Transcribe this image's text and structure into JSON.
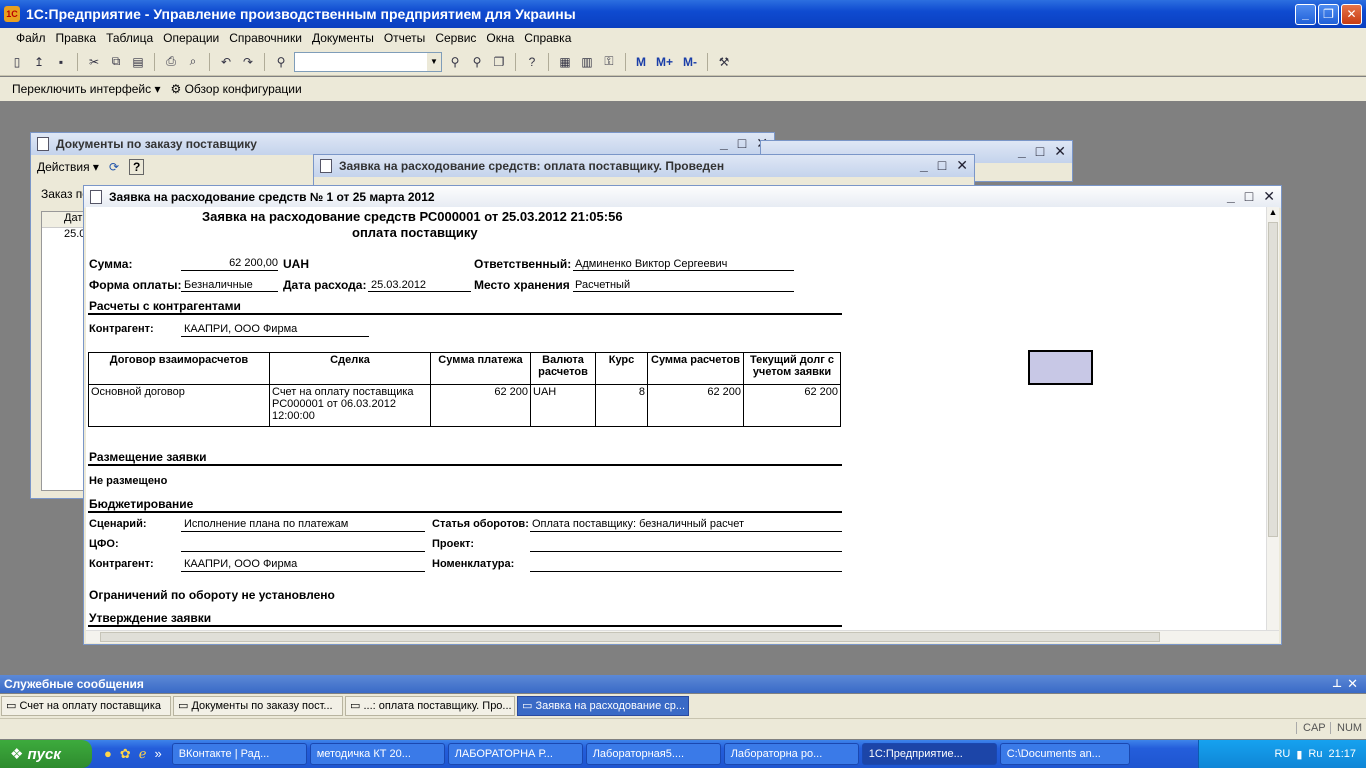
{
  "app": {
    "title": "1С:Предприятие - Управление производственным предприятием для Украины",
    "logo": "1С"
  },
  "menu": [
    "Файл",
    "Правка",
    "Таблица",
    "Операции",
    "Справочники",
    "Документы",
    "Отчеты",
    "Сервис",
    "Окна",
    "Справка"
  ],
  "toolbar2": {
    "switch_interface": "Переключить интерфейс",
    "config_overview": "Обзор конфигурации"
  },
  "memory_buttons": [
    "M",
    "M+",
    "M-"
  ],
  "win_docs": {
    "title": "Документы по заказу поставщику",
    "actions": "Действия",
    "label_prefix": "Заказ по",
    "col_date": "Дат",
    "row_date": "25.0"
  },
  "win_request": {
    "title": "Заявка на расходование средств: оплата поставщику. Проведен"
  },
  "win_report": {
    "title": "Заявка на расходование средств № 1 от 25 марта 2012",
    "heading1": "Заявка на расходование средств РС000001 от 25.03.2012 21:05:56",
    "heading2": "оплата поставщику",
    "sum_label": "Сумма:",
    "sum_value": "62 200,00",
    "currency": "UAH",
    "responsible_label": "Ответственный:",
    "responsible_value": "Админенко Виктор Сергеевич",
    "pay_form_label": "Форма оплаты:",
    "pay_form_value": "Безналичные",
    "date_label": "Дата расхода:",
    "date_value": "25.03.2012",
    "storage_label": "Место хранения",
    "storage_value": "Расчетный",
    "section_settlements": "Расчеты с контрагентами",
    "counterparty_label": "Контрагент:",
    "counterparty_value": "КААПРИ, ООО Фирма",
    "table_headers": [
      "Договор взаиморасчетов",
      "Сделка",
      "Сумма платежа",
      "Валюта расчетов",
      "Курс",
      "Сумма расчетов",
      "Текущий долг с учетом заявки"
    ],
    "table_row": {
      "contract": "Основной договор",
      "deal": "Счет на оплату поставщика РС000001 от 06.03.2012 12:00:00",
      "pay_sum": "62 200",
      "currency": "UAH",
      "rate": "8",
      "settle_sum": "62 200",
      "debt": "62 200"
    },
    "section_placement": "Размещение заявки",
    "placement_value": "Не размещено",
    "section_budget": "Бюджетирование",
    "scenario_label": "Сценарий:",
    "scenario_value": "Исполнение плана по платежам",
    "turnover_label": "Статья оборотов:",
    "turnover_value": "Оплата поставщику: безналичный расчет",
    "cfo_label": "ЦФО:",
    "project_label": "Проект:",
    "counterparty2_label": "Контрагент:",
    "counterparty2_value": "КААПРИ, ООО Фирма",
    "nomenclature_label": "Номенклатура:",
    "limits_text": "Ограничений по обороту не установлено",
    "section_approval": "Утверждение заявки"
  },
  "service_messages": "Служебные сообщения",
  "window_tabs": [
    "Счет на оплату поставщика",
    "Документы по заказу пост...",
    "...: оплата поставщику. Про...",
    "Заявка на расходование ср..."
  ],
  "status": {
    "cap": "CAP",
    "num": "NUM"
  },
  "taskbar": {
    "start": "пуск",
    "buttons": [
      "ВКонтакте | Рад...",
      "методичка КТ 20...",
      "ЛАБОРАТОРНА Р...",
      "Лабораторная5....",
      "Лабораторна ро...",
      "1С:Предприятие...",
      "C:\\Documents an..."
    ],
    "lang": "RU",
    "lang_badge": "Ru",
    "clock": "21:17"
  }
}
